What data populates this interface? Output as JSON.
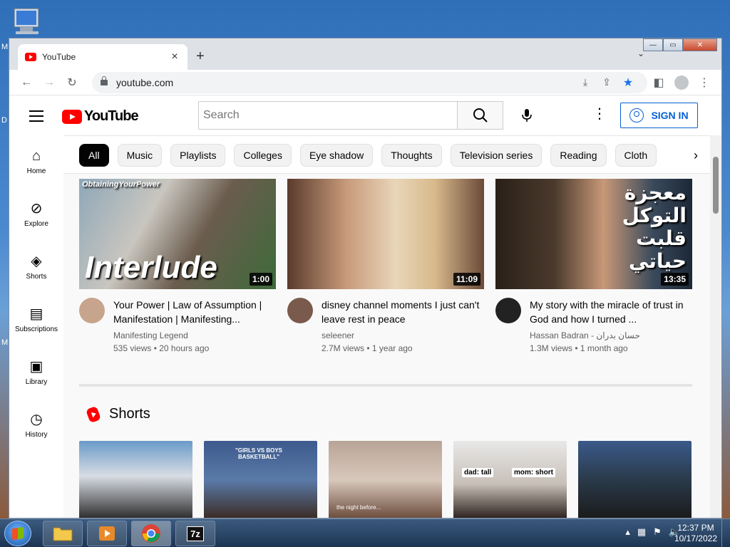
{
  "browser": {
    "tab_title": "YouTube",
    "url": "youtube.com"
  },
  "youtube": {
    "search_placeholder": "Search",
    "sign_in": "SIGN IN",
    "sidebar": [
      {
        "label": "Home",
        "icon": "home-icon"
      },
      {
        "label": "Explore",
        "icon": "compass-icon"
      },
      {
        "label": "Shorts",
        "icon": "shorts-icon"
      },
      {
        "label": "Subscriptions",
        "icon": "subscriptions-icon"
      },
      {
        "label": "Library",
        "icon": "library-icon"
      },
      {
        "label": "History",
        "icon": "history-icon"
      }
    ],
    "chips": [
      "All",
      "Music",
      "Playlists",
      "Colleges",
      "Eye shadow",
      "Thoughts",
      "Television series",
      "Reading",
      "Cloth"
    ],
    "videos": [
      {
        "thumb_text": "Interlude",
        "thumb_top_text": "ObtainingYourPower",
        "duration": "1:00",
        "title": "Your Power | Law of Assumption | Manifestation | Manifesting...",
        "channel": "Manifesting Legend",
        "stats": "535 views • 20 hours ago"
      },
      {
        "duration": "11:09",
        "title": "disney channel moments I just can't leave rest in peace",
        "channel": "seleener",
        "stats": "2.7M views • 1 year ago"
      },
      {
        "thumb_text": "معجزة التوكل قلبت حياتي",
        "duration": "13:35",
        "title": "My story with the miracle of trust in God and how I turned ...",
        "channel": "Hassan Badran - حسان بدران",
        "stats": "1.3M views • 1 month ago"
      }
    ],
    "shorts_title": "Shorts",
    "shorts_labels": [
      "\"GIRLS VS BOYS BASKETBALL\"",
      "the night before...",
      "dad: tall",
      "mom: short"
    ]
  },
  "taskbar": {
    "time": "12:37 PM",
    "date": "10/17/2022"
  }
}
